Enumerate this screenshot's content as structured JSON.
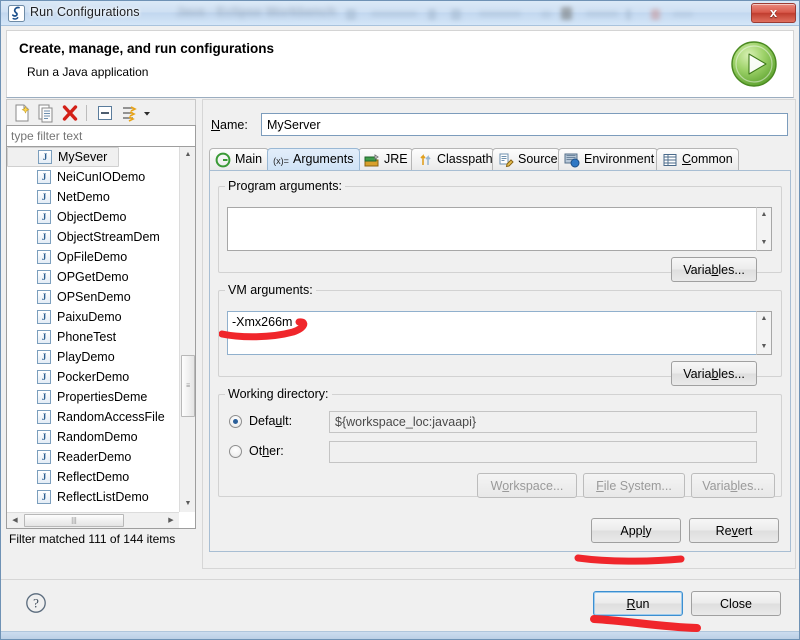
{
  "window": {
    "title": "Run Configurations",
    "title_icon": "run-configurations-icon",
    "close_label": "x",
    "ghost_texts": [
      "Java - Eclipse Workbench"
    ]
  },
  "header": {
    "title": "Create, manage, and run configurations",
    "subtitle": "Run a Java application",
    "run_icon": "green-play-icon"
  },
  "tree_toolbar": {
    "buttons": [
      {
        "name": "new-configuration-button",
        "icon": "new-document-icon",
        "tooltip": "New launch configuration"
      },
      {
        "name": "duplicate-configuration-button",
        "icon": "duplicate-icon",
        "tooltip": "Duplicate"
      },
      {
        "name": "delete-configuration-button",
        "icon": "delete-red-x-icon",
        "tooltip": "Delete"
      },
      {
        "name": "collapse-all-button",
        "icon": "collapse-all-icon",
        "tooltip": "Collapse All"
      },
      {
        "name": "filter-button",
        "icon": "filter-arrows-icon",
        "tooltip": "Filter"
      },
      {
        "name": "filter-dropdown-button",
        "icon": "chevron-down-icon",
        "tooltip": "Menu"
      }
    ]
  },
  "filter": {
    "placeholder": "type filter text",
    "value": "",
    "status": "Filter matched 111 of 144 items"
  },
  "tree": {
    "items": [
      {
        "label": "MySever",
        "icon": "java-class-icon",
        "selected": true
      },
      {
        "label": "NeiCunIODemo",
        "icon": "java-class-icon",
        "selected": false
      },
      {
        "label": "NetDemo",
        "icon": "java-class-icon",
        "selected": false
      },
      {
        "label": "ObjectDemo",
        "icon": "java-class-icon",
        "selected": false
      },
      {
        "label": "ObjectStreamDem",
        "icon": "java-class-icon",
        "selected": false
      },
      {
        "label": "OpFileDemo",
        "icon": "java-class-icon",
        "selected": false
      },
      {
        "label": "OPGetDemo",
        "icon": "java-class-icon",
        "selected": false
      },
      {
        "label": "OPSenDemo",
        "icon": "java-class-icon",
        "selected": false
      },
      {
        "label": "PaixuDemo",
        "icon": "java-class-icon",
        "selected": false
      },
      {
        "label": "PhoneTest",
        "icon": "java-class-icon",
        "selected": false
      },
      {
        "label": "PlayDemo",
        "icon": "java-class-icon",
        "selected": false
      },
      {
        "label": "PockerDemo",
        "icon": "java-class-icon",
        "selected": false
      },
      {
        "label": "PropertiesDeme",
        "icon": "java-class-icon",
        "selected": false
      },
      {
        "label": "RandomAccessFile",
        "icon": "java-class-icon",
        "selected": false
      },
      {
        "label": "RandomDemo",
        "icon": "java-class-icon",
        "selected": false
      },
      {
        "label": "ReaderDemo",
        "icon": "java-class-icon",
        "selected": false
      },
      {
        "label": "ReflectDemo",
        "icon": "java-class-icon",
        "selected": false
      },
      {
        "label": "ReflectListDemo",
        "icon": "java-class-icon",
        "selected": false
      }
    ]
  },
  "config": {
    "name_label": "Name:",
    "name_label_mnemonic": "N",
    "name_value": "MyServer"
  },
  "tabs": [
    {
      "label": "Main",
      "icon": "main-green-circle-icon",
      "active": false
    },
    {
      "label": "Arguments",
      "icon": "arguments-xeq-icon",
      "active": true
    },
    {
      "label": "JRE",
      "icon": "jre-books-icon",
      "active": false
    },
    {
      "label": "Classpath",
      "icon": "classpath-arrows-icon",
      "active": false
    },
    {
      "label": "Source",
      "icon": "source-pencil-icon",
      "active": false
    },
    {
      "label": "Environment",
      "icon": "environment-icon",
      "active": false
    },
    {
      "label": "Common",
      "icon": "common-grid-icon",
      "active": false
    }
  ],
  "program_arguments": {
    "legend": "Program arguments:",
    "value": "",
    "variables_button": "Variables..."
  },
  "vm_arguments": {
    "legend": "VM arguments:",
    "value": "-Xmx266m",
    "variables_button": "Variables..."
  },
  "working_directory": {
    "legend": "Working directory:",
    "default_label": "Default:",
    "default_value": "${workspace_loc:javaapi}",
    "default_selected": true,
    "other_label": "Other:",
    "other_value": "",
    "other_selected": false,
    "buttons": {
      "workspace": "Workspace...",
      "file_system": "File System...",
      "variables": "Variables..."
    }
  },
  "form_buttons": {
    "apply": "Apply",
    "revert": "Revert"
  },
  "dialog_buttons": {
    "help_icon": "help-question-icon",
    "run": "Run",
    "close": "Close"
  },
  "annotations": {
    "color": "#f0262b",
    "marks": [
      {
        "name": "vm-arguments-underline",
        "target": "-Xmx266m"
      },
      {
        "name": "apply-button-underline",
        "target": "Apply"
      },
      {
        "name": "run-button-underline",
        "target": "Run"
      }
    ]
  }
}
